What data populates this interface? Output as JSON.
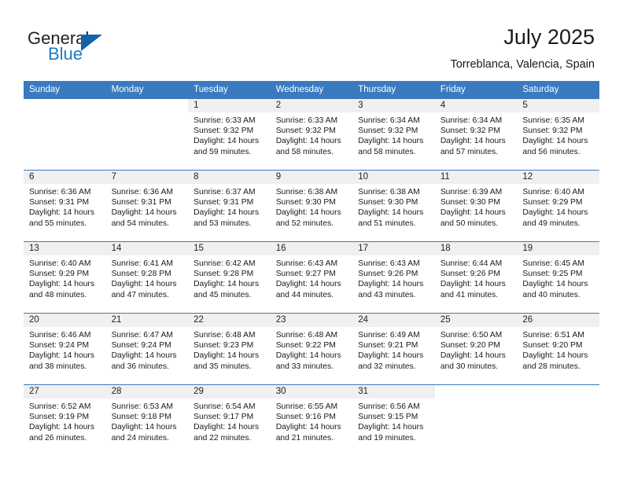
{
  "brand": {
    "name_general": "General",
    "name_blue": "Blue",
    "accent_color": "#1a7dc4",
    "triangle_color": "#1064a8"
  },
  "header": {
    "title": "July 2025",
    "subtitle": "Torreblanca, Valencia, Spain"
  },
  "theme": {
    "header_blue": "#3a7ac0",
    "daynum_band": "#f0f0f0",
    "text": "#1a1a1a"
  },
  "weekday_headers": [
    "Sunday",
    "Monday",
    "Tuesday",
    "Wednesday",
    "Thursday",
    "Friday",
    "Saturday"
  ],
  "weeks": [
    [
      {
        "day": "",
        "blank": true
      },
      {
        "day": "",
        "blank": true
      },
      {
        "day": "1",
        "sunrise": "Sunrise: 6:33 AM",
        "sunset": "Sunset: 9:32 PM",
        "daylight": "Daylight: 14 hours and 59 minutes."
      },
      {
        "day": "2",
        "sunrise": "Sunrise: 6:33 AM",
        "sunset": "Sunset: 9:32 PM",
        "daylight": "Daylight: 14 hours and 58 minutes."
      },
      {
        "day": "3",
        "sunrise": "Sunrise: 6:34 AM",
        "sunset": "Sunset: 9:32 PM",
        "daylight": "Daylight: 14 hours and 58 minutes."
      },
      {
        "day": "4",
        "sunrise": "Sunrise: 6:34 AM",
        "sunset": "Sunset: 9:32 PM",
        "daylight": "Daylight: 14 hours and 57 minutes."
      },
      {
        "day": "5",
        "sunrise": "Sunrise: 6:35 AM",
        "sunset": "Sunset: 9:32 PM",
        "daylight": "Daylight: 14 hours and 56 minutes."
      }
    ],
    [
      {
        "day": "6",
        "sunrise": "Sunrise: 6:36 AM",
        "sunset": "Sunset: 9:31 PM",
        "daylight": "Daylight: 14 hours and 55 minutes."
      },
      {
        "day": "7",
        "sunrise": "Sunrise: 6:36 AM",
        "sunset": "Sunset: 9:31 PM",
        "daylight": "Daylight: 14 hours and 54 minutes."
      },
      {
        "day": "8",
        "sunrise": "Sunrise: 6:37 AM",
        "sunset": "Sunset: 9:31 PM",
        "daylight": "Daylight: 14 hours and 53 minutes."
      },
      {
        "day": "9",
        "sunrise": "Sunrise: 6:38 AM",
        "sunset": "Sunset: 9:30 PM",
        "daylight": "Daylight: 14 hours and 52 minutes."
      },
      {
        "day": "10",
        "sunrise": "Sunrise: 6:38 AM",
        "sunset": "Sunset: 9:30 PM",
        "daylight": "Daylight: 14 hours and 51 minutes."
      },
      {
        "day": "11",
        "sunrise": "Sunrise: 6:39 AM",
        "sunset": "Sunset: 9:30 PM",
        "daylight": "Daylight: 14 hours and 50 minutes."
      },
      {
        "day": "12",
        "sunrise": "Sunrise: 6:40 AM",
        "sunset": "Sunset: 9:29 PM",
        "daylight": "Daylight: 14 hours and 49 minutes."
      }
    ],
    [
      {
        "day": "13",
        "sunrise": "Sunrise: 6:40 AM",
        "sunset": "Sunset: 9:29 PM",
        "daylight": "Daylight: 14 hours and 48 minutes."
      },
      {
        "day": "14",
        "sunrise": "Sunrise: 6:41 AM",
        "sunset": "Sunset: 9:28 PM",
        "daylight": "Daylight: 14 hours and 47 minutes."
      },
      {
        "day": "15",
        "sunrise": "Sunrise: 6:42 AM",
        "sunset": "Sunset: 9:28 PM",
        "daylight": "Daylight: 14 hours and 45 minutes."
      },
      {
        "day": "16",
        "sunrise": "Sunrise: 6:43 AM",
        "sunset": "Sunset: 9:27 PM",
        "daylight": "Daylight: 14 hours and 44 minutes."
      },
      {
        "day": "17",
        "sunrise": "Sunrise: 6:43 AM",
        "sunset": "Sunset: 9:26 PM",
        "daylight": "Daylight: 14 hours and 43 minutes."
      },
      {
        "day": "18",
        "sunrise": "Sunrise: 6:44 AM",
        "sunset": "Sunset: 9:26 PM",
        "daylight": "Daylight: 14 hours and 41 minutes."
      },
      {
        "day": "19",
        "sunrise": "Sunrise: 6:45 AM",
        "sunset": "Sunset: 9:25 PM",
        "daylight": "Daylight: 14 hours and 40 minutes."
      }
    ],
    [
      {
        "day": "20",
        "sunrise": "Sunrise: 6:46 AM",
        "sunset": "Sunset: 9:24 PM",
        "daylight": "Daylight: 14 hours and 38 minutes."
      },
      {
        "day": "21",
        "sunrise": "Sunrise: 6:47 AM",
        "sunset": "Sunset: 9:24 PM",
        "daylight": "Daylight: 14 hours and 36 minutes."
      },
      {
        "day": "22",
        "sunrise": "Sunrise: 6:48 AM",
        "sunset": "Sunset: 9:23 PM",
        "daylight": "Daylight: 14 hours and 35 minutes."
      },
      {
        "day": "23",
        "sunrise": "Sunrise: 6:48 AM",
        "sunset": "Sunset: 9:22 PM",
        "daylight": "Daylight: 14 hours and 33 minutes."
      },
      {
        "day": "24",
        "sunrise": "Sunrise: 6:49 AM",
        "sunset": "Sunset: 9:21 PM",
        "daylight": "Daylight: 14 hours and 32 minutes."
      },
      {
        "day": "25",
        "sunrise": "Sunrise: 6:50 AM",
        "sunset": "Sunset: 9:20 PM",
        "daylight": "Daylight: 14 hours and 30 minutes."
      },
      {
        "day": "26",
        "sunrise": "Sunrise: 6:51 AM",
        "sunset": "Sunset: 9:20 PM",
        "daylight": "Daylight: 14 hours and 28 minutes."
      }
    ],
    [
      {
        "day": "27",
        "sunrise": "Sunrise: 6:52 AM",
        "sunset": "Sunset: 9:19 PM",
        "daylight": "Daylight: 14 hours and 26 minutes."
      },
      {
        "day": "28",
        "sunrise": "Sunrise: 6:53 AM",
        "sunset": "Sunset: 9:18 PM",
        "daylight": "Daylight: 14 hours and 24 minutes."
      },
      {
        "day": "29",
        "sunrise": "Sunrise: 6:54 AM",
        "sunset": "Sunset: 9:17 PM",
        "daylight": "Daylight: 14 hours and 22 minutes."
      },
      {
        "day": "30",
        "sunrise": "Sunrise: 6:55 AM",
        "sunset": "Sunset: 9:16 PM",
        "daylight": "Daylight: 14 hours and 21 minutes."
      },
      {
        "day": "31",
        "sunrise": "Sunrise: 6:56 AM",
        "sunset": "Sunset: 9:15 PM",
        "daylight": "Daylight: 14 hours and 19 minutes."
      },
      {
        "day": "",
        "blank": true
      },
      {
        "day": "",
        "blank": true
      }
    ]
  ]
}
